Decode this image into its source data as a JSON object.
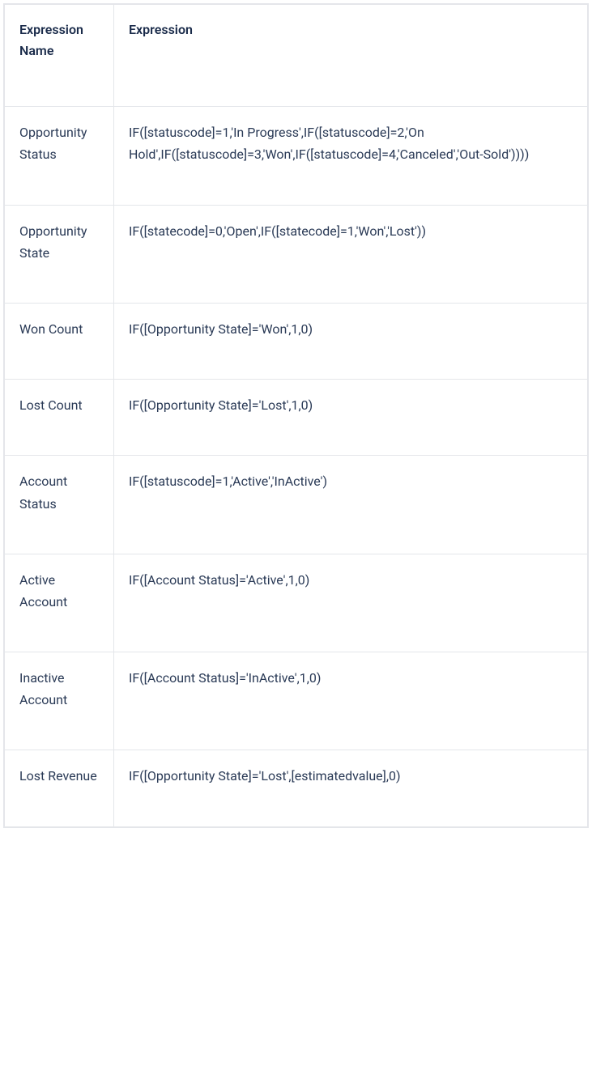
{
  "table": {
    "headers": {
      "name": "Expression Name",
      "expression": "Expression"
    },
    "rows": [
      {
        "name": "Opportunity Status",
        "expression": "IF([statuscode]=1,'In Progress',IF([statuscode]=2,'On Hold',IF([statuscode]=3,'Won',IF([statuscode]=4,'Canceled','Out-Sold'))))"
      },
      {
        "name": "Opportunity State",
        "expression": "IF([statecode]=0,'Open',IF([statecode]=1,'Won','Lost'))"
      },
      {
        "name": "Won Count",
        "expression": "IF([Opportunity State]='Won',1,0)"
      },
      {
        "name": "Lost Count",
        "expression": "IF([Opportunity State]='Lost',1,0)"
      },
      {
        "name": "Account Status",
        "expression": "IF([statuscode]=1,'Active','InActive')"
      },
      {
        "name": "Active Account",
        "expression": "IF([Account Status]='Active',1,0)"
      },
      {
        "name": "Inactive Account",
        "expression": "IF([Account Status]='InActive',1,0)"
      },
      {
        "name": "Lost Revenue",
        "expression": "IF([Opportunity State]='Lost',[estimatedvalue],0)"
      }
    ]
  }
}
